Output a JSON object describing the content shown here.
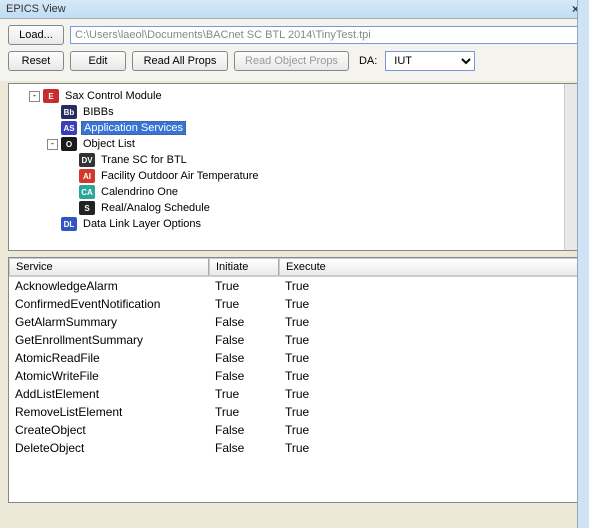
{
  "window": {
    "title": "EPICS View"
  },
  "toolbar": {
    "load": "Load...",
    "path": "C:\\Users\\laeol\\Documents\\BACnet SC BTL 2014\\TinyTest.tpi",
    "reset": "Reset",
    "edit": "Edit",
    "read_all": "Read All Props",
    "read_obj": "Read Object Props",
    "da_label": "DA:",
    "da_value": "IUT"
  },
  "tree": {
    "root": {
      "badge": "E",
      "label": "Sax Control Module",
      "expander": "-"
    },
    "bibbs": {
      "badge": "Bb",
      "label": "BIBBs"
    },
    "appsvcs": {
      "badge": "AS",
      "label": "Application Services"
    },
    "objlist": {
      "badge": "O",
      "label": "Object List",
      "expander": "-"
    },
    "obj1": {
      "badge": "DV",
      "label": "Trane SC for BTL"
    },
    "obj2": {
      "badge": "AI",
      "label": "Facility Outdoor Air Temperature"
    },
    "obj3": {
      "badge": "CA",
      "label": "Calendrino One"
    },
    "obj4": {
      "badge": "S",
      "label": "Real/Analog Schedule"
    },
    "dll": {
      "badge": "DL",
      "label": "Data Link Layer Options"
    }
  },
  "table": {
    "headers": {
      "service": "Service",
      "initiate": "Initiate",
      "execute": "Execute"
    },
    "rows": [
      {
        "service": "AcknowledgeAlarm",
        "initiate": "True",
        "execute": "True"
      },
      {
        "service": "ConfirmedEventNotification",
        "initiate": "True",
        "execute": "True"
      },
      {
        "service": "GetAlarmSummary",
        "initiate": "False",
        "execute": "True"
      },
      {
        "service": "GetEnrollmentSummary",
        "initiate": "False",
        "execute": "True"
      },
      {
        "service": "AtomicReadFile",
        "initiate": "False",
        "execute": "True"
      },
      {
        "service": "AtomicWriteFile",
        "initiate": "False",
        "execute": "True"
      },
      {
        "service": "AddListElement",
        "initiate": "True",
        "execute": "True"
      },
      {
        "service": "RemoveListElement",
        "initiate": "True",
        "execute": "True"
      },
      {
        "service": "CreateObject",
        "initiate": "False",
        "execute": "True"
      },
      {
        "service": "DeleteObject",
        "initiate": "False",
        "execute": "True"
      }
    ]
  }
}
